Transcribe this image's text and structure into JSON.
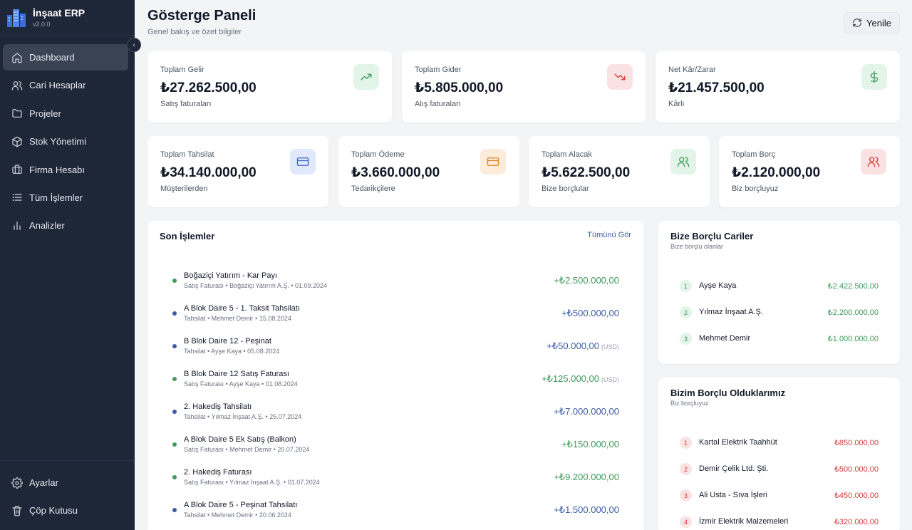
{
  "app": {
    "name": "İnşaat ERP",
    "version": "v2.0.0"
  },
  "nav": {
    "items": [
      {
        "label": "Dashboard",
        "icon": "home-icon"
      },
      {
        "label": "Cari Hesaplar",
        "icon": "users-icon"
      },
      {
        "label": "Projeler",
        "icon": "folder-icon"
      },
      {
        "label": "Stok Yönetimi",
        "icon": "package-icon"
      },
      {
        "label": "Firma Hesabı",
        "icon": "briefcase-icon"
      },
      {
        "label": "Tüm İşlemler",
        "icon": "list-icon"
      },
      {
        "label": "Analizler",
        "icon": "bar-chart-icon"
      }
    ],
    "bottom": [
      {
        "label": "Ayarlar",
        "icon": "gear-icon"
      },
      {
        "label": "Çöp Kutusu",
        "icon": "trash-icon"
      }
    ]
  },
  "header": {
    "title": "Gösterge Paneli",
    "subtitle": "Genel bakış ve özet bilgiler",
    "refresh_label": "Yenile"
  },
  "stats_row1": [
    {
      "label": "Toplam Gelir",
      "value": "₺27.262.500,00",
      "sub": "Satış faturaları",
      "icon": "trending-up-icon",
      "color": "#3f9a5b",
      "bg": "#e3f4e8"
    },
    {
      "label": "Toplam Gider",
      "value": "₺5.805.000,00",
      "sub": "Alış faturaları",
      "icon": "trending-down-icon",
      "color": "#d23b3b",
      "bg": "#fbe2e2"
    },
    {
      "label": "Net Kâr/Zarar",
      "value": "₺21.457.500,00",
      "sub": "Kârlı",
      "icon": "dollar-icon",
      "color": "#3f9a5b",
      "bg": "#e3f4e8"
    }
  ],
  "stats_row2": [
    {
      "label": "Toplam Tahsilat",
      "value": "₺34.140.000,00",
      "sub": "Müşterilerden",
      "icon": "credit-card-icon",
      "color": "#3c63c9",
      "bg": "#e0e8fb"
    },
    {
      "label": "Toplam Ödeme",
      "value": "₺3.660.000,00",
      "sub": "Tedarikçilere",
      "icon": "credit-card-icon",
      "color": "#d9822b",
      "bg": "#fdecd9"
    },
    {
      "label": "Toplam Alacak",
      "value": "₺5.622.500,00",
      "sub": "Bize borçlular",
      "icon": "users-icon",
      "color": "#3f9a5b",
      "bg": "#e3f4e8"
    },
    {
      "label": "Toplam Borç",
      "value": "₺2.120.000,00",
      "sub": "Biz borçluyuz",
      "icon": "users-icon",
      "color": "#d23b3b",
      "bg": "#fbe2e2"
    }
  ],
  "transactions": {
    "title": "Son İşlemler",
    "see_all": "Tümünü Gör",
    "items": [
      {
        "title": "Boğaziçi Yatırım - Kar Payı",
        "meta": "Satış Faturası • Boğaziçi Yatırım A.Ş. • 01.09.2024",
        "amount": "+₺2.500.000,00",
        "currency": "",
        "kind": "green"
      },
      {
        "title": "A Blok Daire 5 - 1. Taksit Tahsilatı",
        "meta": "Tahsilat • Mehmet Demir • 15.08.2024",
        "amount": "+₺500.000,00",
        "currency": "",
        "kind": "blue"
      },
      {
        "title": "B Blok Daire 12 - Peşinat",
        "meta": "Tahsilat • Ayşe Kaya • 05.08.2024",
        "amount": "+₺50.000,00",
        "currency": "(USD)",
        "kind": "blue"
      },
      {
        "title": "B Blok Daire 12 Satış Faturası",
        "meta": "Satış Faturası • Ayşe Kaya • 01.08.2024",
        "amount": "+₺125.000,00",
        "currency": "(USD)",
        "kind": "green"
      },
      {
        "title": "2. Hakediş Tahsilatı",
        "meta": "Tahsilat • Yılmaz İnşaat A.Ş. • 25.07.2024",
        "amount": "+₺7.000.000,00",
        "currency": "",
        "kind": "blue"
      },
      {
        "title": "A Blok Daire 5 Ek Satış (Balkon)",
        "meta": "Satış Faturası • Mehmet Demir • 20.07.2024",
        "amount": "+₺150.000,00",
        "currency": "",
        "kind": "green"
      },
      {
        "title": "2. Hakediş Faturası",
        "meta": "Satış Faturası • Yılmaz İnşaat A.Ş. • 01.07.2024",
        "amount": "+₺9.200.000,00",
        "currency": "",
        "kind": "green"
      },
      {
        "title": "A Blok Daire 5 - Peşinat Tahsilatı",
        "meta": "Tahsilat • Mehmet Demir • 20.06.2024",
        "amount": "+₺1.500.000,00",
        "currency": "",
        "kind": "blue"
      }
    ]
  },
  "receivables": {
    "title": "Bize Borçlu Cariler",
    "subtitle": "Bize borçlu olanlar",
    "color": "#3f9a5b",
    "items": [
      {
        "num": "1",
        "name": "Ayşe Kaya",
        "amount": "₺2.422.500,00"
      },
      {
        "num": "2",
        "name": "Yılmaz İnşaat A.Ş.",
        "amount": "₺2.200.000,00"
      },
      {
        "num": "3",
        "name": "Mehmet Demir",
        "amount": "₺1.000.000,00"
      }
    ]
  },
  "payables": {
    "title": "Bizim Borçlu Olduklarımız",
    "subtitle": "Biz borçluyuz",
    "color": "#d23b3b",
    "items": [
      {
        "num": "1",
        "name": "Kartal Elektrik Taahhüt",
        "amount": "₺850.000,00"
      },
      {
        "num": "2",
        "name": "Demir Çelik Ltd. Şti.",
        "amount": "₺500.000,00"
      },
      {
        "num": "3",
        "name": "Ali Usta - Sıva İşleri",
        "amount": "₺450.000,00"
      },
      {
        "num": "4",
        "name": "İzmir Elektrik Malzemeleri",
        "amount": "₺320.000,00"
      }
    ]
  }
}
